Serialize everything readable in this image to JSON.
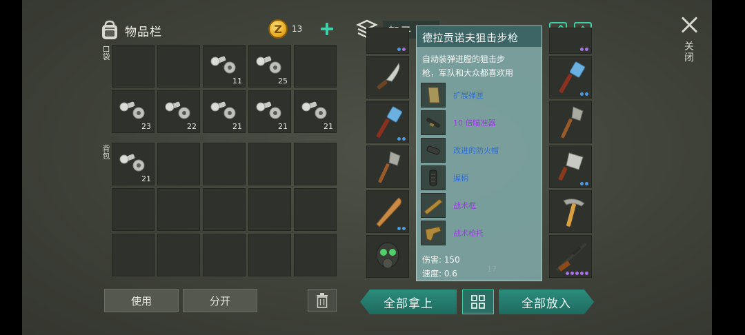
{
  "inventory": {
    "title": "物品栏",
    "coins": "13",
    "pocket_label": "口袋",
    "backpack_label": "背包",
    "pocket_counts": [
      "",
      "",
      "11",
      "25",
      "",
      "23",
      "22",
      "21",
      "21",
      "21"
    ],
    "backpack_counts": [
      "21",
      "",
      "",
      "",
      "",
      "",
      "",
      "",
      "",
      "",
      "",
      "",
      "",
      "",
      ""
    ],
    "use_button": "使用",
    "split_button": "分开"
  },
  "storage": {
    "title": "架子 箱",
    "take_all": "全部拿上",
    "put_all": "全部放入",
    "hidden_slot_count": "17"
  },
  "tooltip": {
    "name": "德拉贡诺夫狙击步枪",
    "description_line1": "自动装弹进膛的狙击步",
    "description_line2": "枪，军队和大众都喜欢用",
    "attachments": [
      {
        "name": "扩展弹匣",
        "rarity": "blue"
      },
      {
        "name": "10 倍瞄准器",
        "rarity": "purple"
      },
      {
        "name": "改进的防火帽",
        "rarity": "blue"
      },
      {
        "name": "握柄",
        "rarity": "blue"
      },
      {
        "name": "战术框",
        "rarity": "purple"
      },
      {
        "name": "战术枪托",
        "rarity": "purple"
      }
    ],
    "damage": "伤害: 150",
    "speed": "速度: 0.6"
  },
  "close": {
    "label_top": "关",
    "label_bottom": "闭"
  },
  "colors": {
    "accent": "#3fd0a8",
    "rarity_blue": "#2f6fd8",
    "rarity_purple": "#9a3fe0"
  }
}
